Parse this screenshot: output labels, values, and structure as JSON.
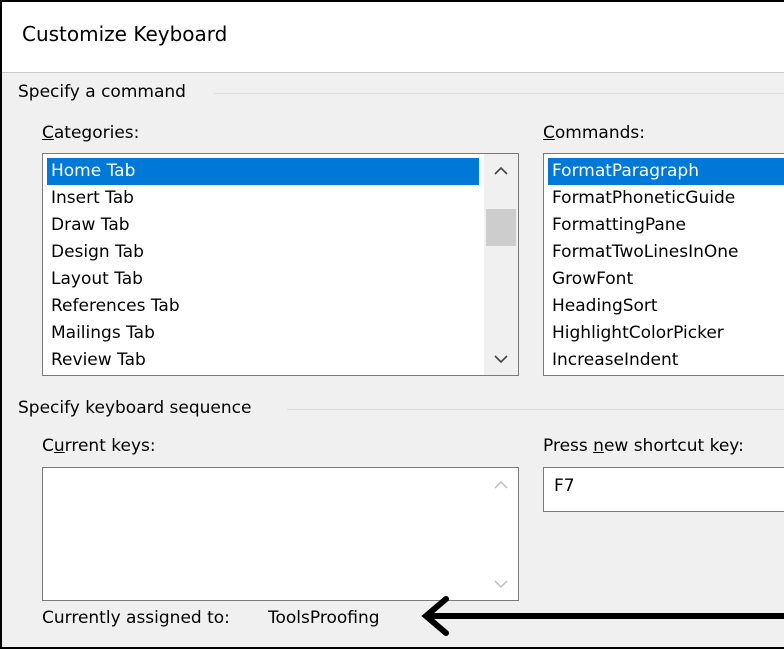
{
  "dialog": {
    "title": "Customize Keyboard"
  },
  "specify_command": {
    "group_label": "Specify a command",
    "categories_label": {
      "underline": "C",
      "rest": "ategories:"
    },
    "commands_label": {
      "underline": "C",
      "rest": "ommands:"
    },
    "categories": [
      {
        "label": "Home Tab",
        "selected": true
      },
      {
        "label": "Insert Tab",
        "selected": false
      },
      {
        "label": "Draw Tab",
        "selected": false
      },
      {
        "label": "Design Tab",
        "selected": false
      },
      {
        "label": "Layout Tab",
        "selected": false
      },
      {
        "label": "References Tab",
        "selected": false
      },
      {
        "label": "Mailings Tab",
        "selected": false
      },
      {
        "label": "Review Tab",
        "selected": false
      }
    ],
    "commands": [
      {
        "label": "FormatParagraph",
        "selected": true
      },
      {
        "label": "FormatPhoneticGuide",
        "selected": false
      },
      {
        "label": "FormattingPane",
        "selected": false
      },
      {
        "label": "FormatTwoLinesInOne",
        "selected": false
      },
      {
        "label": "GrowFont",
        "selected": false
      },
      {
        "label": "HeadingSort",
        "selected": false
      },
      {
        "label": "HighlightColorPicker",
        "selected": false
      },
      {
        "label": "IncreaseIndent",
        "selected": false
      }
    ]
  },
  "keyboard_sequence": {
    "group_label": "Specify keyboard sequence",
    "current_keys_label": {
      "pre": "C",
      "underline": "u",
      "rest": "rrent keys:"
    },
    "press_new_label": {
      "pre": "Press ",
      "underline": "n",
      "rest": "ew shortcut key:"
    },
    "new_shortcut_value": "F7",
    "current_keys": []
  },
  "assignment": {
    "label": "Currently assigned to:",
    "value": "ToolsProofing"
  },
  "colors": {
    "selection": "#0078d7",
    "panel": "#f0f0f0",
    "arrow": "#000000"
  },
  "icons": {
    "scroll_up": "chevron-up-icon",
    "scroll_down": "chevron-down-icon",
    "annotation": "left-arrow-annotation"
  }
}
